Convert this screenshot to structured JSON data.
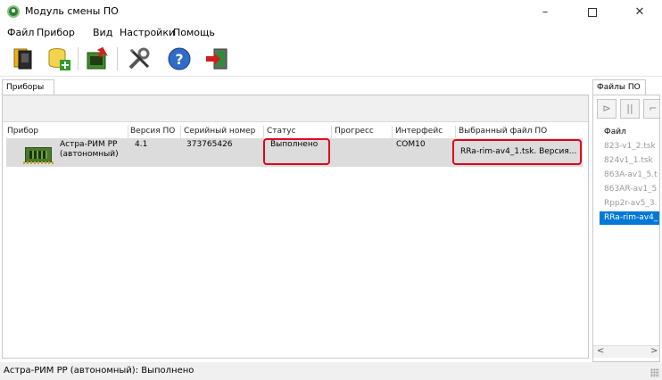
{
  "window": {
    "title": "Модуль смены ПО",
    "controls": {
      "minimize": "–",
      "close": "✕"
    }
  },
  "menu": [
    {
      "label": "Файл"
    },
    {
      "label": "Прибор"
    },
    {
      "label": "Вид"
    },
    {
      "label": "Настройки"
    },
    {
      "label": "Помощь"
    }
  ],
  "toolbar": {
    "buttons": [
      {
        "icon": "device-icon"
      },
      {
        "icon": "add-database-icon"
      },
      {
        "icon": "firmware-load-icon"
      },
      {
        "icon": "tools-icon"
      },
      {
        "icon": "help-icon",
        "glyph": "?"
      },
      {
        "icon": "exit-icon"
      }
    ]
  },
  "left_panel": {
    "tab": "Приборы",
    "columns": [
      {
        "label": "Прибор"
      },
      {
        "label": "Версия ПО"
      },
      {
        "label": "Серийный номер"
      },
      {
        "label": "Статус"
      },
      {
        "label": "Прогресс"
      },
      {
        "label": "Интерфейс"
      },
      {
        "label": "Выбранный файл ПО"
      }
    ],
    "rows": [
      {
        "device_line1": "Астра-РИМ РР",
        "device_line2": "(автономный)",
        "version": "4.1",
        "serial": "373765426",
        "status": "Выполнено",
        "progress": "",
        "interface": "COM10",
        "file": "RRa-rim-av4_1.tsk. Версия..."
      }
    ],
    "highlight_color": "#e0001b"
  },
  "right_panel": {
    "tab": "Файлы ПО",
    "buttons": [
      {
        "glyph": "⊳"
      },
      {
        "glyph": "||"
      },
      {
        "glyph": "⌐"
      }
    ],
    "header": "Файл",
    "files": [
      {
        "name": "823-v1_2.tsk"
      },
      {
        "name": "824v1_1.tsk"
      },
      {
        "name": "863A-av1_5.t"
      },
      {
        "name": "863AR-av1_5"
      },
      {
        "name": "Rpp2r-av5_3."
      },
      {
        "name": "RRa-rim-av4_",
        "selected": true
      }
    ],
    "scroll_left": "<",
    "scroll_right": ">",
    "selection_color": "#0078d7"
  },
  "status_bar": {
    "text": "Астра-РИМ РР (автономный): Выполнено"
  }
}
